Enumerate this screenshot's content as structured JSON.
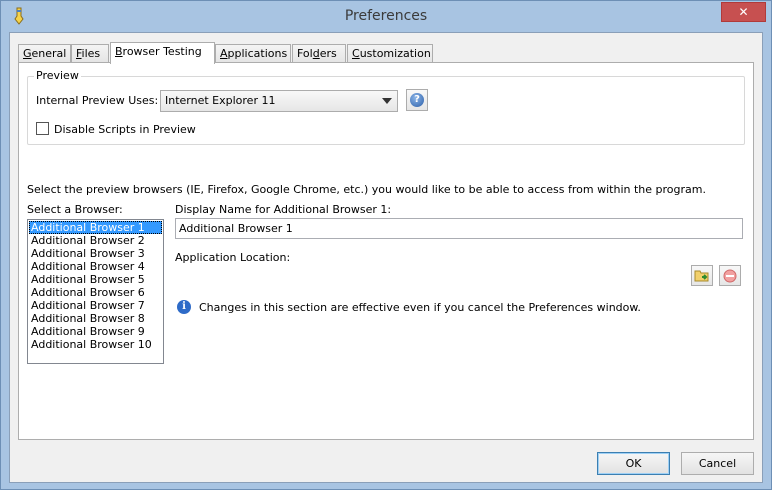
{
  "window": {
    "title": "Preferences",
    "close_glyph": "✕"
  },
  "tabs": [
    {
      "label": "General",
      "accel": "G",
      "rest": "eneral"
    },
    {
      "label": "Files",
      "accel": "F",
      "rest": "iles"
    },
    {
      "label": "Browser Testing",
      "accel": "B",
      "rest": "rowser Testing"
    },
    {
      "label": "Applications",
      "accel": "A",
      "rest": "pplications"
    },
    {
      "label": "Folders",
      "pre": "Fol",
      "accel": "d",
      "rest": "ers"
    },
    {
      "label": "Customization",
      "accel": "C",
      "rest": "ustomization"
    }
  ],
  "preview": {
    "group_title": "Preview",
    "internal_label": "Internal Preview Uses:",
    "internal_value": "Internet Explorer 11",
    "disable_scripts_label": "Disable Scripts in Preview",
    "disable_scripts_checked": false,
    "help_glyph": "?"
  },
  "browsers": {
    "instructions": "Select the preview browsers (IE, Firefox, Google Chrome, etc.) you would like to be able to access from within the program.",
    "select_label": "Select a Browser:",
    "items": [
      "Additional Browser 1",
      "Additional Browser 2",
      "Additional Browser 3",
      "Additional Browser 4",
      "Additional Browser 5",
      "Additional Browser 6",
      "Additional Browser 7",
      "Additional Browser 8",
      "Additional Browser 9",
      "Additional Browser 10"
    ],
    "selected_index": 0,
    "display_name_label": "Display Name for Additional Browser 1:",
    "display_name_value": "Additional Browser 1",
    "app_location_label": "Application Location:",
    "info_glyph": "i",
    "info_text": "Changes in this section are effective even if you cancel the Preferences window."
  },
  "buttons": {
    "ok": "OK",
    "cancel": "Cancel"
  },
  "colors": {
    "accent": "#3399ff",
    "title_bar": "#a8c4e2",
    "close": "#c75050"
  }
}
